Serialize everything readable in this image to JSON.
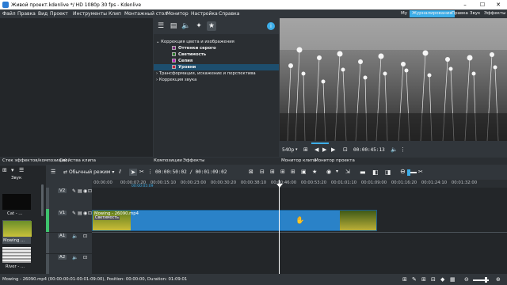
{
  "window": {
    "title": "Живой проект.kdenlive */ HD 1080p 30 fps - Kdenlive",
    "minimize": "–",
    "maximize": "☐",
    "close": "✕"
  },
  "menu": [
    "Файл",
    "Правка",
    "Вид",
    "Проект",
    "Инструменты",
    "Клип",
    "Монтажный стол",
    "Монитор",
    "Настройка",
    "Справка"
  ],
  "layouts": [
    "My",
    "Журналирование",
    "Правка",
    "Звук",
    "Эффекты"
  ],
  "effects": {
    "tree": [
      {
        "label": "Коррекция цвета и изображения",
        "expanded": true,
        "indent": 0
      },
      {
        "label": "Оттенки серого",
        "indent": 1,
        "color": "#7b2a7b",
        "bold": true
      },
      {
        "label": "Светимость",
        "indent": 1,
        "color": "#2b7b2b",
        "bold": true
      },
      {
        "label": "Сепия",
        "indent": 1,
        "color": "#c020c0",
        "bold": true
      },
      {
        "label": "Уровни",
        "indent": 1,
        "color": "#c02040",
        "bold": true,
        "selected": true
      },
      {
        "label": "Трансформация, искажение и перспектива",
        "expanded": false,
        "indent": 0
      },
      {
        "label": "Коррекция звука",
        "expanded": false,
        "indent": 0
      }
    ]
  },
  "monitor": {
    "zoom": "540p",
    "timecode": "00:00:45:13"
  },
  "tabs": {
    "left": [
      "Стек эффектов/композиций",
      "Свойства клипа"
    ],
    "middle": [
      "Композиции",
      "Эффекты"
    ],
    "right": [
      "Монитор клипа",
      "Монитор проекта"
    ]
  },
  "timeline": {
    "mode": "Обычный режим",
    "timecode": "00:00:50:02 / 00:01:09:02",
    "ruler": [
      "00:00:00",
      "00:00:07:20",
      "00:00:15:10",
      "00:00:23:00",
      "00:00:30:20",
      "00:00:38:10",
      "00:00:46:00",
      "00:00:53:20",
      "00:01:01:10",
      "00:01:09:00",
      "00:01:16:20",
      "00:01:24:10",
      "00:01:32:00"
    ],
    "zone_label": "00:00:05:09",
    "tracks": [
      "V2",
      "V1",
      "A1",
      "A2"
    ],
    "clip": {
      "name": "Mowing - 26090.mp4",
      "effect": "Светимость"
    }
  },
  "bin": {
    "header": "Звук",
    "items": [
      "Cat - ...",
      "Mowing ...",
      "River - ..."
    ]
  },
  "status": "Mowing - 26090.mp4 (00:00:00:01-00:01:09:00), Position: 00:00:00, Duration: 01:09:01",
  "colors": {
    "accent": "#3daee9",
    "clip_blue": "#2a82c8",
    "panel": "#31363b"
  }
}
